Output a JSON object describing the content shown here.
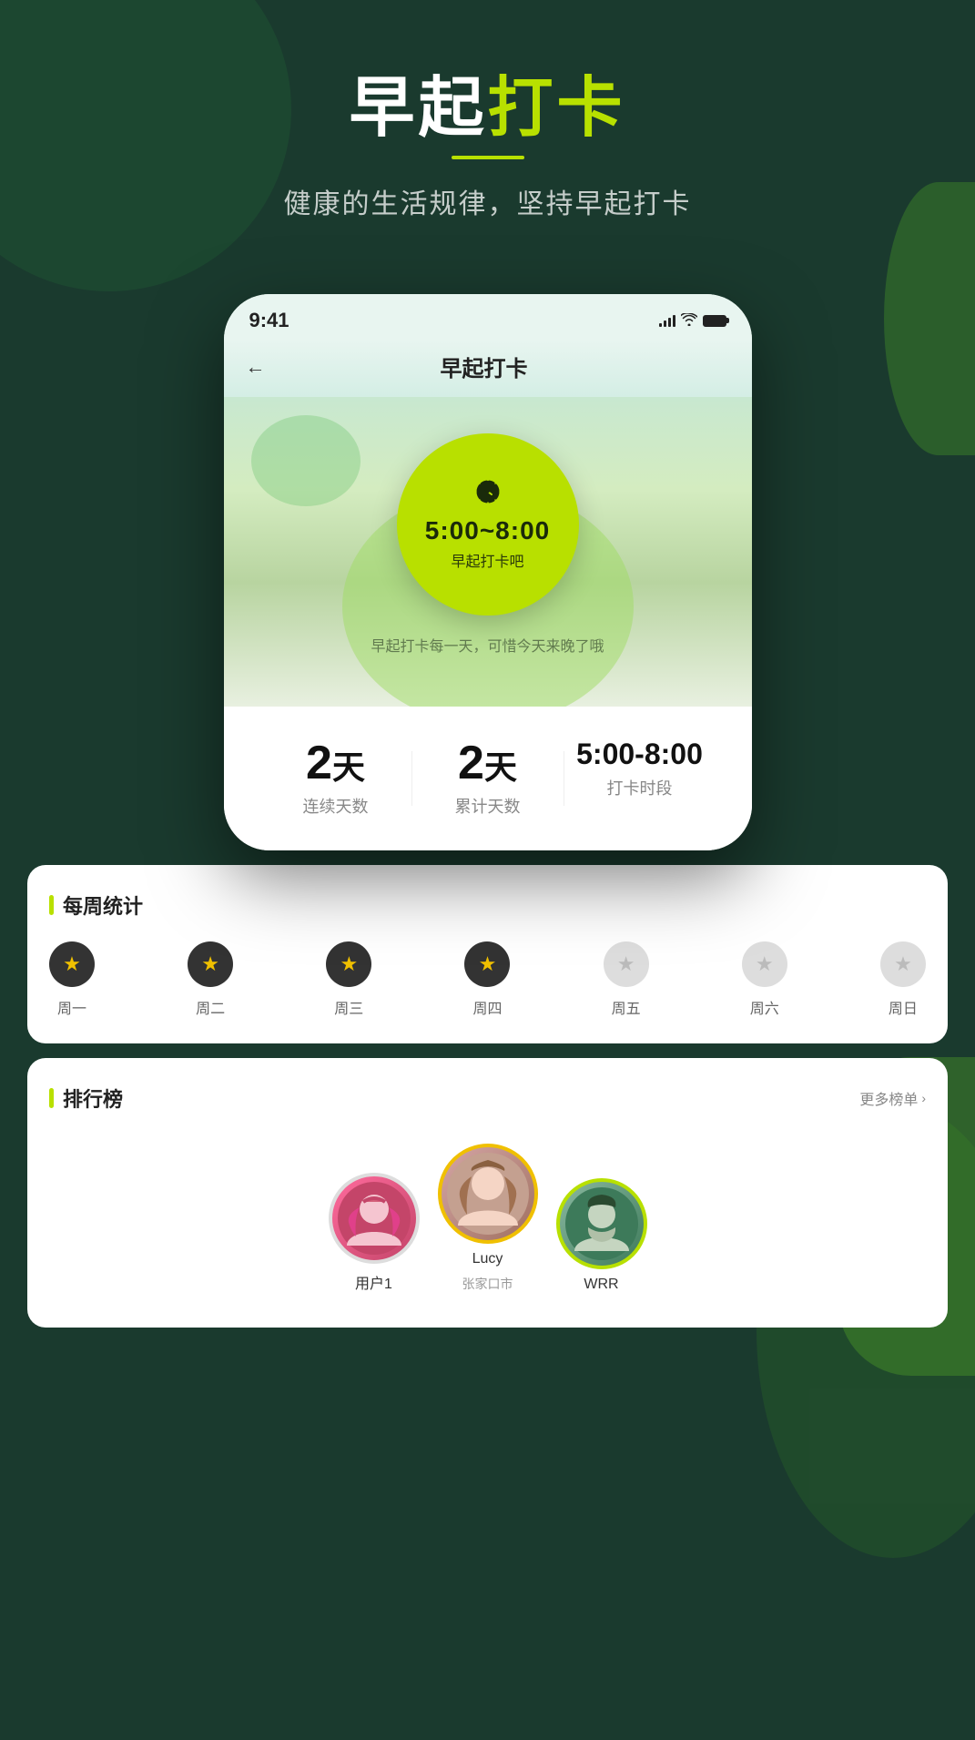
{
  "page": {
    "title_static": "早起",
    "title_accent": "打卡",
    "subtitle": "健康的生活规律，坚持早起打卡",
    "title_underline": true
  },
  "phone": {
    "status_bar": {
      "time": "9:41"
    },
    "navbar": {
      "back_label": "←",
      "title": "早起打卡"
    },
    "clock_circle": {
      "time_range": "5:00~8:00",
      "label": "早起打卡吧"
    },
    "hint_text": "早起打卡每一天，可惜今天来晚了哦"
  },
  "stats": {
    "consecutive_value": "2",
    "consecutive_unit": "天",
    "consecutive_label": "连续天数",
    "total_value": "2",
    "total_unit": "天",
    "total_label": "累计天数",
    "time_range": "5:00-8:00",
    "time_label": "打卡时段"
  },
  "weekly": {
    "section_title": "每周统计",
    "days": [
      {
        "label": "周一",
        "active": true
      },
      {
        "label": "周二",
        "active": true
      },
      {
        "label": "周三",
        "active": true
      },
      {
        "label": "周四",
        "active": true
      },
      {
        "label": "周五",
        "active": false
      },
      {
        "label": "周六",
        "active": false
      },
      {
        "label": "周日",
        "active": false
      }
    ]
  },
  "ranking": {
    "section_title": "排行榜",
    "more_label": "更多榜单",
    "users": [
      {
        "name": "用户1",
        "location": "",
        "rank": 2,
        "emoji": "👩‍🦰"
      },
      {
        "name": "Lucy",
        "location": "张家口市",
        "rank": 1,
        "emoji": "👩"
      },
      {
        "name": "WRR",
        "location": "",
        "rank": 3,
        "emoji": "👨"
      }
    ]
  },
  "icons": {
    "clock": "🕐",
    "star_filled": "★",
    "star_empty": "★",
    "back_arrow": "←",
    "chevron_right": "›"
  }
}
